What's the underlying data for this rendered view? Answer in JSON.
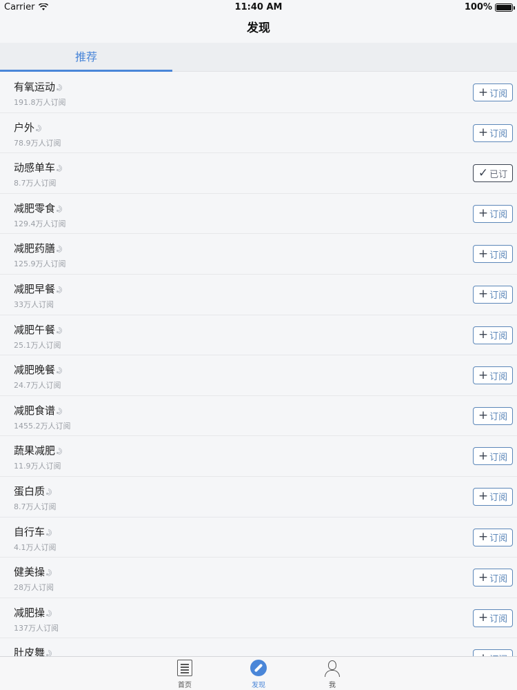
{
  "status_bar": {
    "carrier": "Carrier",
    "time": "11:40 AM",
    "battery": "100%"
  },
  "nav": {
    "title": "发现"
  },
  "tabs": [
    {
      "label": "推荐"
    }
  ],
  "items": [
    {
      "title": "有氧运动",
      "subscribers": "191.8万人订阅",
      "button": "订阅",
      "subscribed": false
    },
    {
      "title": "户外",
      "subscribers": "78.9万人订阅",
      "button": "订阅",
      "subscribed": false
    },
    {
      "title": "动感单车",
      "subscribers": "8.7万人订阅",
      "button": "已订",
      "subscribed": true
    },
    {
      "title": "减肥零食",
      "subscribers": "129.4万人订阅",
      "button": "订阅",
      "subscribed": false
    },
    {
      "title": "减肥药膳",
      "subscribers": "125.9万人订阅",
      "button": "订阅",
      "subscribed": false
    },
    {
      "title": "减肥早餐",
      "subscribers": "33万人订阅",
      "button": "订阅",
      "subscribed": false
    },
    {
      "title": "减肥午餐",
      "subscribers": "25.1万人订阅",
      "button": "订阅",
      "subscribed": false
    },
    {
      "title": "减肥晚餐",
      "subscribers": "24.7万人订阅",
      "button": "订阅",
      "subscribed": false
    },
    {
      "title": "减肥食谱",
      "subscribers": "1455.2万人订阅",
      "button": "订阅",
      "subscribed": false
    },
    {
      "title": "蔬果减肥",
      "subscribers": "11.9万人订阅",
      "button": "订阅",
      "subscribed": false
    },
    {
      "title": "蛋白质",
      "subscribers": "8.7万人订阅",
      "button": "订阅",
      "subscribed": false
    },
    {
      "title": "自行车",
      "subscribers": "4.1万人订阅",
      "button": "订阅",
      "subscribed": false
    },
    {
      "title": "健美操",
      "subscribers": "28万人订阅",
      "button": "订阅",
      "subscribed": false
    },
    {
      "title": "减肥操",
      "subscribers": "137万人订阅",
      "button": "订阅",
      "subscribed": false
    },
    {
      "title": "肚皮舞",
      "subscribers": "",
      "button": "订阅",
      "subscribed": false
    }
  ],
  "tab_bar": [
    {
      "label": "首页",
      "icon": "document-icon",
      "active": false
    },
    {
      "label": "发现",
      "icon": "compass-icon",
      "active": true
    },
    {
      "label": "我",
      "icon": "person-icon",
      "active": false
    }
  ],
  "colors": {
    "accent": "#4a86d8",
    "button_border": "#5b86b8",
    "background": "#f5f6f8"
  }
}
